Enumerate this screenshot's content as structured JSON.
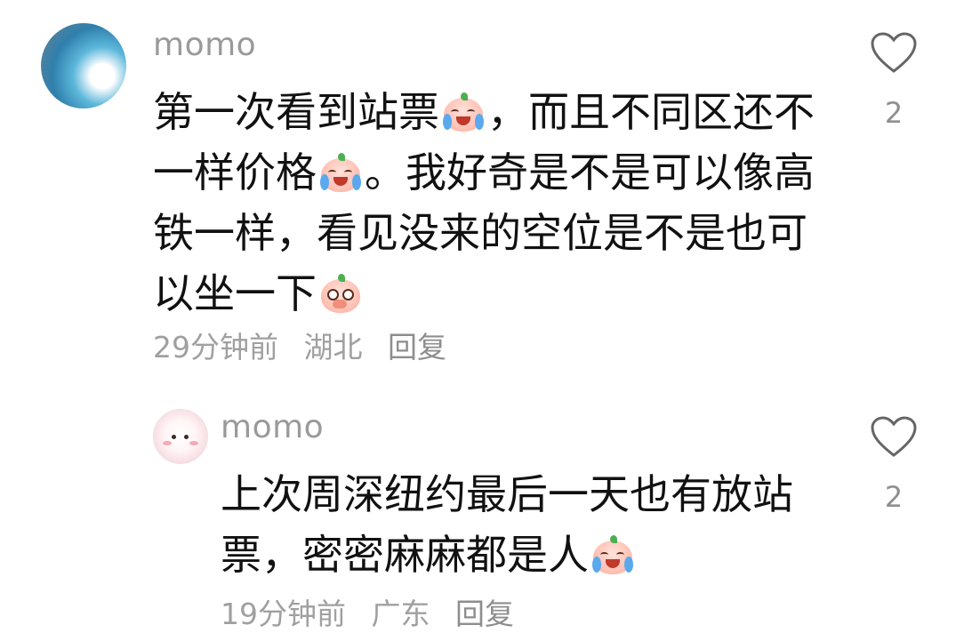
{
  "comments": [
    {
      "username": "momo",
      "text_segments": [
        "第一次看到站票",
        "，而且不同区还不一样价格",
        "。我好奇是不是可以像高铁一样，看见没来的空位是不是也可以坐一下"
      ],
      "emoji_names": [
        "crying-laugh-emoji",
        "crying-laugh-emoji",
        "shy-cover-mouth-emoji"
      ],
      "time": "29分钟前",
      "location": "湖北",
      "reply_label": "回复",
      "like_count": "2",
      "like_icon": "heart-outline-icon"
    },
    {
      "username": "momo",
      "text_segments": [
        "上次周深纽约最后一天也有放站票，密密麻麻都是人"
      ],
      "emoji_names": [
        "crying-laugh-emoji"
      ],
      "time": "19分钟前",
      "location": "广东",
      "reply_label": "回复",
      "like_count": "2",
      "like_icon": "heart-outline-icon"
    }
  ],
  "colors": {
    "text": "#111111",
    "meta": "#a0a0a0",
    "username": "#9a9a9a"
  }
}
